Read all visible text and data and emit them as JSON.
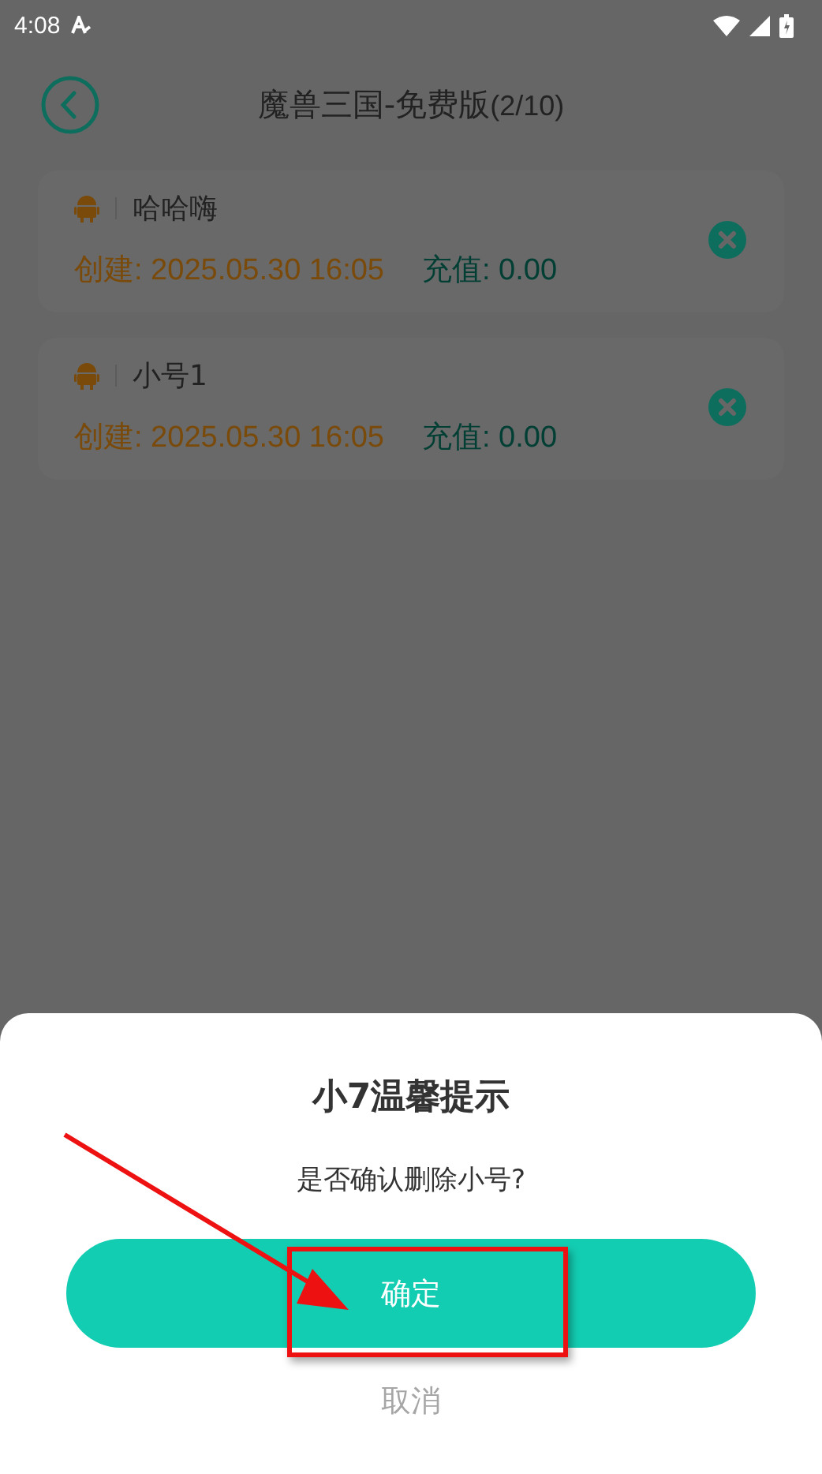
{
  "status_bar": {
    "time": "4:08"
  },
  "header": {
    "title": "魔兽三国-免费版",
    "count": "(2/10)"
  },
  "accounts": [
    {
      "name": "哈哈嗨",
      "created": "创建: 2025.05.30 16:05",
      "recharge": "充值: 0.00"
    },
    {
      "name": "小号1",
      "created": "创建: 2025.05.30 16:05",
      "recharge": "充值: 0.00"
    }
  ],
  "dialog": {
    "title": "小7温馨提示",
    "message": "是否确认删除小号?",
    "confirm": "确定",
    "cancel": "取消"
  }
}
